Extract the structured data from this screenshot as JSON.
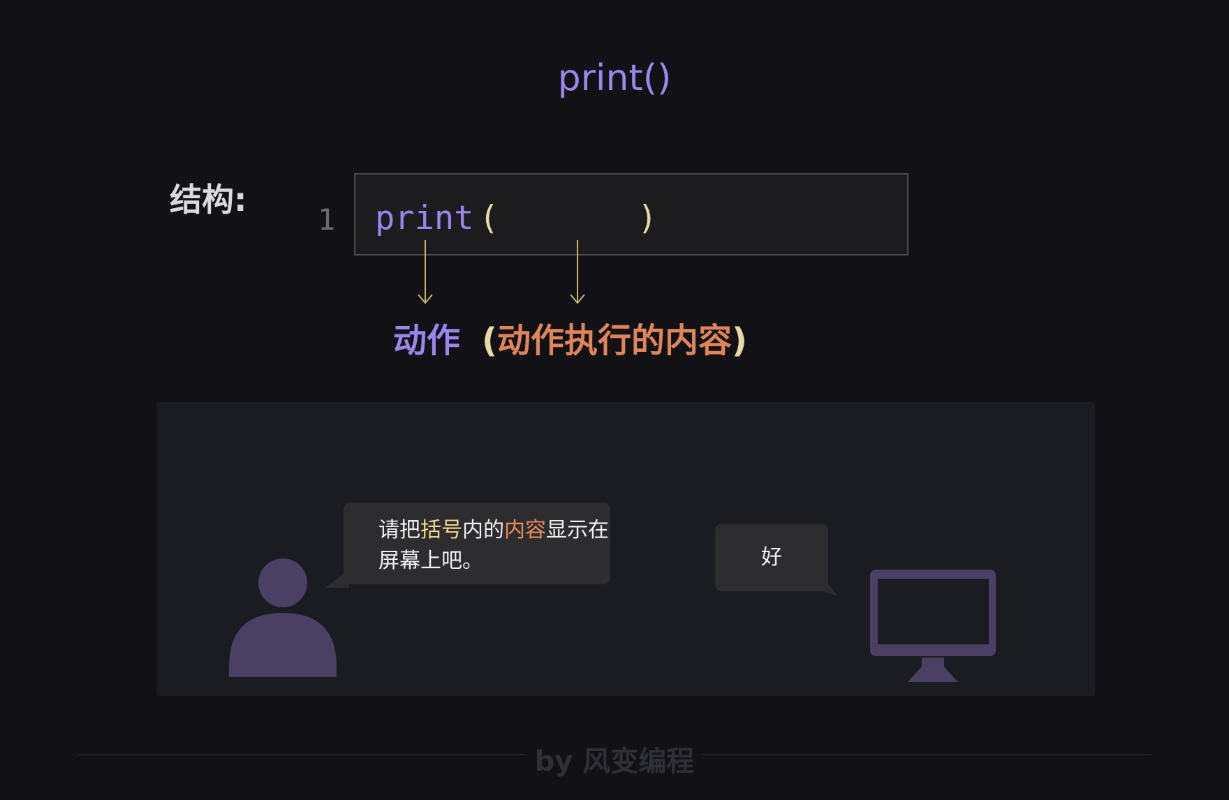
{
  "title": "print()",
  "structure_label": "结构:",
  "code": {
    "line_number": "1",
    "keyword": "print",
    "open_paren": "(",
    "close_paren": ")"
  },
  "explanation": {
    "action": "动作",
    "open_paren": "(",
    "content": "动作执行的内容",
    "close_paren": ")"
  },
  "dialog": {
    "person_text_parts": [
      "请把",
      "括号",
      "内的",
      "内容",
      "显示在屏幕上吧。"
    ],
    "computer_reply": "好"
  },
  "footer": "by 风变编程",
  "colors": {
    "background": "#111116",
    "accent_purple": "#9a86ee",
    "accent_orange": "#e0855a",
    "paren_yellow": "#e8d9a4",
    "arrow_yellow": "#c8b86a",
    "figure_purple": "#4a4063"
  },
  "icons": [
    "person-icon",
    "monitor-icon",
    "down-arrow-icon"
  ]
}
